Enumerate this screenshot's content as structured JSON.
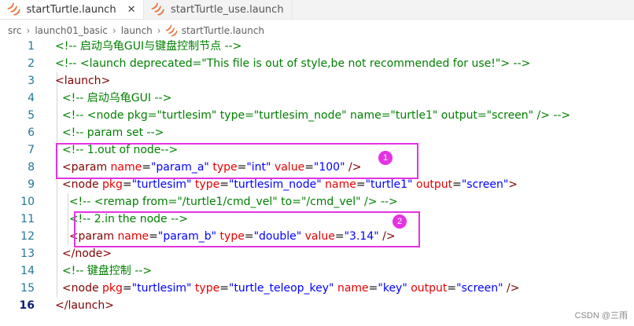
{
  "tabs": [
    {
      "label": "startTurtle.launch",
      "active": true,
      "close_glyph": "✕"
    },
    {
      "label": "startTurtle_use.launch",
      "active": false
    }
  ],
  "breadcrumb": [
    "src",
    "launch01_basic",
    "launch",
    "startTurtle.launch"
  ],
  "lines": [
    {
      "num": "1",
      "tokens": [
        [
          "c",
          "<!-- 启动乌龟GUI与键盘控制节点 -->"
        ]
      ]
    },
    {
      "num": "2",
      "tokens": [
        [
          "c",
          "<!-- <launch deprecated=\"This file is out of style,be not recommended for use!\"> -->"
        ]
      ]
    },
    {
      "num": "3",
      "tokens": [
        [
          "t",
          "<launch>"
        ]
      ]
    },
    {
      "num": "4",
      "tokens": [
        [
          "p",
          "  "
        ],
        [
          "c",
          "<!-- 启动乌龟GUI -->"
        ]
      ]
    },
    {
      "num": "5",
      "tokens": [
        [
          "p",
          "  "
        ],
        [
          "c",
          "<!-- <node pkg=\"turtlesim\" type=\"turtlesim_node\" name=\"turtle1\" output=\"screen\" /> -->"
        ]
      ]
    },
    {
      "num": "6",
      "tokens": [
        [
          "p",
          "  "
        ],
        [
          "c",
          "<!-- param set -->"
        ]
      ]
    },
    {
      "num": "7",
      "tokens": [
        [
          "p",
          "  "
        ],
        [
          "c",
          "<!-- 1.out of node-->"
        ]
      ]
    },
    {
      "num": "8",
      "tokens": [
        [
          "p",
          "  "
        ],
        [
          "t",
          "<param"
        ],
        [
          "p",
          " "
        ],
        [
          "a",
          "name"
        ],
        [
          "p",
          "="
        ],
        [
          "v",
          "\"param_a\""
        ],
        [
          "p",
          " "
        ],
        [
          "a",
          "type"
        ],
        [
          "p",
          "="
        ],
        [
          "v",
          "\"int\""
        ],
        [
          "p",
          " "
        ],
        [
          "a",
          "value"
        ],
        [
          "p",
          "="
        ],
        [
          "v",
          "\"100\""
        ],
        [
          "p",
          " "
        ],
        [
          "t",
          "/>"
        ]
      ]
    },
    {
      "num": "9",
      "tokens": [
        [
          "p",
          "  "
        ],
        [
          "t",
          "<node"
        ],
        [
          "p",
          " "
        ],
        [
          "a",
          "pkg"
        ],
        [
          "p",
          "="
        ],
        [
          "v",
          "\"turtlesim\""
        ],
        [
          "p",
          " "
        ],
        [
          "a",
          "type"
        ],
        [
          "p",
          "="
        ],
        [
          "v",
          "\"turtlesim_node\""
        ],
        [
          "p",
          " "
        ],
        [
          "a",
          "name"
        ],
        [
          "p",
          "="
        ],
        [
          "v",
          "\"turtle1\""
        ],
        [
          "p",
          " "
        ],
        [
          "a",
          "output"
        ],
        [
          "p",
          "="
        ],
        [
          "v",
          "\"screen\""
        ],
        [
          "t",
          ">"
        ]
      ]
    },
    {
      "num": "10",
      "tokens": [
        [
          "p",
          "    "
        ],
        [
          "c",
          "<!-- <remap from=\"/turtle1/cmd_vel\" to=\"/cmd_vel\" /> -->"
        ]
      ]
    },
    {
      "num": "11",
      "tokens": [
        [
          "p",
          "    "
        ],
        [
          "c",
          "<!-- 2.in the node -->"
        ]
      ]
    },
    {
      "num": "12",
      "tokens": [
        [
          "p",
          "    "
        ],
        [
          "t",
          "<param"
        ],
        [
          "p",
          " "
        ],
        [
          "a",
          "name"
        ],
        [
          "p",
          "="
        ],
        [
          "v",
          "\"param_b\""
        ],
        [
          "p",
          " "
        ],
        [
          "a",
          "type"
        ],
        [
          "p",
          "="
        ],
        [
          "v",
          "\"double\""
        ],
        [
          "p",
          " "
        ],
        [
          "a",
          "value"
        ],
        [
          "p",
          "="
        ],
        [
          "v",
          "\"3.14\""
        ],
        [
          "p",
          " "
        ],
        [
          "t",
          "/>"
        ]
      ]
    },
    {
      "num": "13",
      "tokens": [
        [
          "p",
          "  "
        ],
        [
          "t",
          "</node>"
        ]
      ]
    },
    {
      "num": "14",
      "tokens": [
        [
          "p",
          "  "
        ],
        [
          "c",
          "<!-- 键盘控制 -->"
        ]
      ]
    },
    {
      "num": "15",
      "tokens": [
        [
          "p",
          "  "
        ],
        [
          "t",
          "<node"
        ],
        [
          "p",
          " "
        ],
        [
          "a",
          "pkg"
        ],
        [
          "p",
          "="
        ],
        [
          "v",
          "\"turtlesim\""
        ],
        [
          "p",
          " "
        ],
        [
          "a",
          "type"
        ],
        [
          "p",
          "="
        ],
        [
          "v",
          "\"turtle_teleop_key\""
        ],
        [
          "p",
          " "
        ],
        [
          "a",
          "name"
        ],
        [
          "p",
          "="
        ],
        [
          "v",
          "\"key\""
        ],
        [
          "p",
          " "
        ],
        [
          "a",
          "output"
        ],
        [
          "p",
          "="
        ],
        [
          "v",
          "\"screen\""
        ],
        [
          "p",
          " "
        ],
        [
          "t",
          "/>"
        ]
      ]
    },
    {
      "num": "16",
      "tokens": [
        [
          "t",
          "</launch>"
        ]
      ],
      "current": true
    }
  ],
  "annotations": [
    {
      "label": "1",
      "color": "#e433e4"
    },
    {
      "label": "2",
      "color": "#e433e4"
    }
  ],
  "watermark": "CSDN @三雨",
  "colors": {
    "comment": "#008000",
    "tag": "#800000",
    "attribute": "#e50000",
    "value": "#0000ff",
    "line_number": "#237893",
    "highlight": "#e433e4"
  }
}
